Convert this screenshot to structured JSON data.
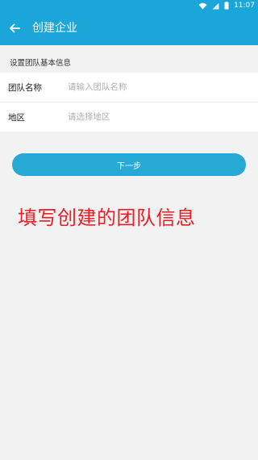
{
  "status_bar": {
    "time": "11:07",
    "icons": [
      "wifi-icon",
      "signal-icon",
      "battery-icon"
    ]
  },
  "header": {
    "back_icon": "arrow-left-icon",
    "title": "创建企业"
  },
  "section": {
    "title": "设置团队基本信息"
  },
  "form": {
    "team_name": {
      "label": "团队名称",
      "placeholder": "请输入团队名称",
      "value": ""
    },
    "region": {
      "label": "地区",
      "placeholder": "请选择地区",
      "value": ""
    }
  },
  "actions": {
    "next_label": "下一步"
  },
  "caption": {
    "text": "填写创建的团队信息"
  },
  "colors": {
    "primary": "#1aa6d8",
    "button": "#27a9d6",
    "caption": "#ee1c24",
    "background": "#f2f2f2"
  }
}
